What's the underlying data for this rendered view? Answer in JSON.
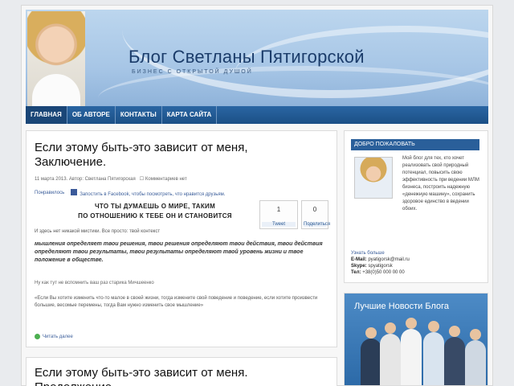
{
  "header": {
    "title": "Блог Светланы Пятигорской",
    "subtitle": "БИЗНЕС С ОТКРЫТОЙ ДУШОЙ"
  },
  "nav": {
    "items": [
      "ГЛАВНАЯ",
      "ОБ АВТОРЕ",
      "КОНТАКТЫ",
      "КАРТА САЙТА"
    ]
  },
  "post": {
    "title": "Если этому быть-это зависит от меня, Заключение.",
    "meta": "11 марта 2013. Автор: Светлана Пятигорская",
    "comments": "Комментариев нет",
    "share_left": "Понравилось",
    "share_right": "Запостить в Facebook, чтобы посмотреть, что нравится друзьям.",
    "quote_line1": "ЧТО ТЫ ДУМАЕШЬ О МИРЕ, ТАКИМ",
    "quote_line2": "ПО ОТНОШЕНИЮ К ТЕБЕ ОН И СТАНОВИТСЯ",
    "counter_left_num": "1",
    "counter_left_label": "Tweet",
    "counter_right_num": "0",
    "counter_right_label": "Поделиться",
    "p1": "И здесь нет никакой мистики. Все просто: твой контекст",
    "p2": "мышления определяет твои решения, твои решения определяют твои действия, твои действия определяют твои результаты, твои результаты определяют твой уровень жизни и твое положение в обществе.",
    "p3": "Ну как тут не вспомнить ваш раз старика Мичшеенко",
    "p4": "«Если Вы хотите изменить что-то малое в своей жизни, тогда изменитe свой поведение и поведение, если хотите произвести большие, весомые перемены, тогда Вам нужно изменить свое мышление»",
    "readmore": "Читать далее"
  },
  "post2": {
    "title": "Если этому быть-это зависит от меня. Продолжение..."
  },
  "widget": {
    "title": "ДОБРО ПОЖАЛОВАТЬ",
    "text": "Мой блог для тех, кто хочет реализовать свой природный потенциал, повысить свою эффективность при ведении МЛМ бизнеса, построить надежную «денежную машину», сохранить здоровое единство в ведении обоих.",
    "name": "Узнать больше",
    "email_label": "E-Mail:",
    "email": "pyatigorsk@mail.ru",
    "skype_label": "Skype:",
    "skype": "spyatigorsk",
    "phone_label": "Тел:",
    "phone": "+38(0)50 000 00 00"
  },
  "banner": {
    "title": "Лучшие Новости Блога"
  },
  "colors": {
    "nav": "#1b4f86",
    "accent": "#2a5f9a",
    "banner": "#3b7ab8"
  }
}
